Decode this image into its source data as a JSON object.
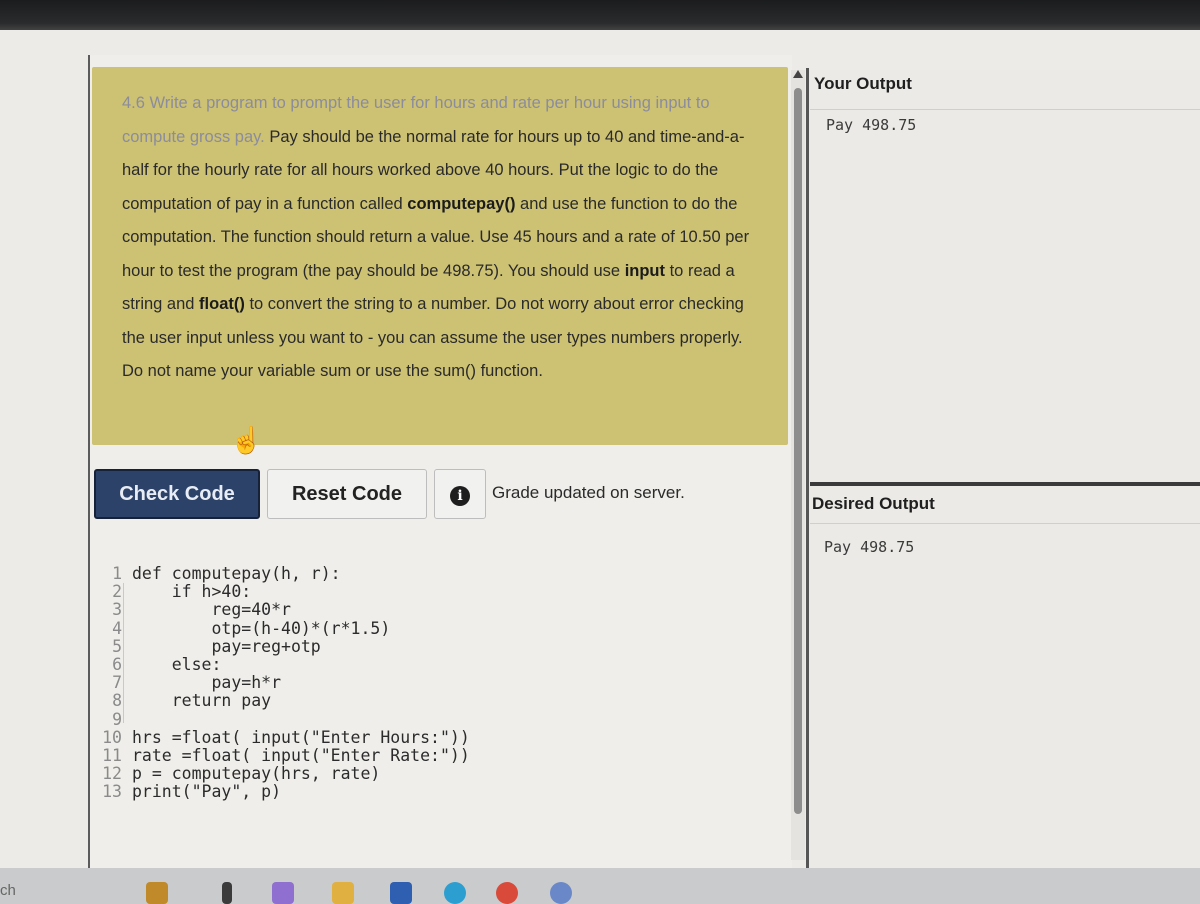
{
  "instructions": {
    "p1": "4.6 Write a program to prompt the user for hours and rate per hour using input to compute gross pay.",
    "p2": " Pay should be the normal rate for hours up to 40 and time-and-a-half for the hourly rate for all hours worked above 40 hours. Put the logic to do the computation of pay in a function called ",
    "fn_name": "computepay()",
    "p3": " and use the function to do the computation. The function should return a value. Use 45 hours and a rate of 10.50 per hour to test the program (the pay should be 498.75). You should use ",
    "input_word": "input",
    "p4": " to read a string and ",
    "float_word": "float()",
    "p5": " to convert the string to a number. Do not worry about error checking the user input unless you want to - you can assume the user types numbers properly. Do not name your variable sum or use the sum() function."
  },
  "toolbar": {
    "check_label": "Check Code",
    "reset_label": "Reset Code",
    "info_glyph": "i",
    "grade_status": "Grade updated on server."
  },
  "code": {
    "lines": [
      {
        "n": "1",
        "text": "def computepay(h, r):"
      },
      {
        "n": "2",
        "text": "    if h>40:"
      },
      {
        "n": "3",
        "text": "        reg=40*r"
      },
      {
        "n": "4",
        "text": "        otp=(h-40)*(r*1.5)"
      },
      {
        "n": "5",
        "text": "        pay=reg+otp"
      },
      {
        "n": "6",
        "text": "    else:"
      },
      {
        "n": "7",
        "text": "        pay=h*r"
      },
      {
        "n": "8",
        "text": "    return pay"
      },
      {
        "n": "9",
        "text": ""
      },
      {
        "n": "10",
        "text": "hrs =float( input(\"Enter Hours:\"))"
      },
      {
        "n": "11",
        "text": "rate =float( input(\"Enter Rate:\"))"
      },
      {
        "n": "12",
        "text": "p = computepay(hrs, rate)"
      },
      {
        "n": "13",
        "text": "print(\"Pay\", p)"
      }
    ]
  },
  "your_output": {
    "title": "Your Output",
    "text": "Pay 498.75"
  },
  "desired_output": {
    "title": "Desired Output",
    "text": "Pay 498.75"
  },
  "taskbar": {
    "search_fragment": "ch"
  },
  "colors": {
    "instructions_bg": "#cdc174",
    "check_button_bg": "#2d4268",
    "panel_bg": "#ebeae6"
  }
}
